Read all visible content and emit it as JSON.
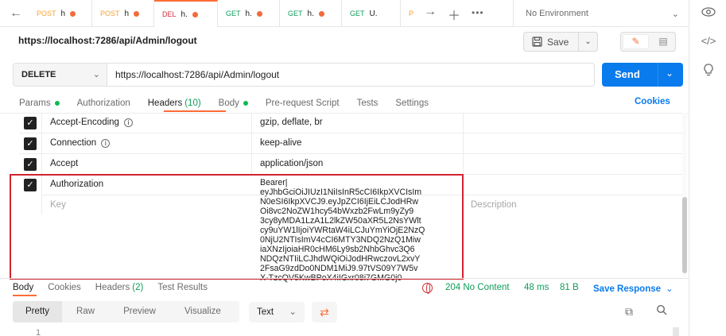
{
  "tabs": [
    {
      "method": "POST",
      "name": "h",
      "dot": true
    },
    {
      "method": "POST",
      "name": "h",
      "dot": true
    },
    {
      "method": "DEL",
      "name": "h.",
      "dot": true
    },
    {
      "method": "GET",
      "name": "h.",
      "dot": true
    },
    {
      "method": "GET",
      "name": "h.",
      "dot": true
    },
    {
      "method": "GET",
      "name": "U.",
      "dot": false
    },
    {
      "method": "P",
      "name": "",
      "dot": false
    }
  ],
  "environment": {
    "label": "No Environment"
  },
  "request": {
    "title": "https://localhost:7286/api/Admin/logout",
    "save_label": "Save",
    "method": "DELETE",
    "url": "https://localhost:7286/api/Admin/logout",
    "send_label": "Send"
  },
  "subtabs": {
    "params": "Params",
    "authorization": "Authorization",
    "headers": "Headers",
    "headers_count": "(10)",
    "body": "Body",
    "prerequest": "Pre-request Script",
    "tests": "Tests",
    "settings": "Settings",
    "cookies": "Cookies"
  },
  "headers": {
    "rows": [
      {
        "key": "Accept-Encoding",
        "value": "gzip, deflate, br"
      },
      {
        "key": "Connection",
        "value": "keep-alive"
      },
      {
        "key": "Accept",
        "value": "application/json"
      }
    ],
    "auth": {
      "key": "Authorization",
      "value": "Bearer|\neyJhbGciOiJIUzI1NiIsInR5cCI6IkpXVCIsIm\nN0eSI6IkpXVCJ9.eyJpZCI6IjEiLCJodHRw\nOi8vc2NoZW1hcy54bWxzb2FwLm9yZy9\n3cy8yMDA1LzA1L2lkZW50aXR5L2NsYWlt\ncy9uYW1lIjoiYWRtaW4iLCJuYmYiOjE2NzQ\n0NjU2NTIsImV4cCI6MTY3NDQ2NzQ1Miw\niaXNzIjoiaHR0cHM6Ly9sb2NhbGhvc3Q6\nNDQzNTIiLCJhdWQiOiJodHRwczovL2xvY\n2FsaG9zdDo0NDM1MiJ9.97tVS09Y7W5v\nX-TzcQV5KwBPoX4iIGxr08i7GMG0j0"
    },
    "placeholder_key": "Key",
    "placeholder_desc": "Description"
  },
  "response": {
    "tabs": {
      "body": "Body",
      "cookies": "Cookies",
      "headers": "Headers",
      "headers_count": "(2)",
      "test_results": "Test Results"
    },
    "status": "204 No Content",
    "time": "48 ms",
    "size": "81 B",
    "save_response": "Save Response",
    "view_options": [
      "Pretty",
      "Raw",
      "Preview",
      "Visualize"
    ],
    "format": "Text",
    "line_number": "1"
  },
  "colors": {
    "accent": "#ff6c37",
    "primary": "#097bed",
    "success": "#0f9d58",
    "highlight": "#d1242f"
  }
}
